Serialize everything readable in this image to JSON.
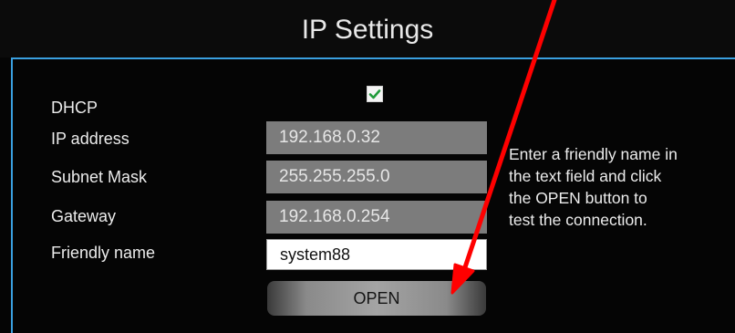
{
  "dialog": {
    "title": "IP Settings"
  },
  "form": {
    "dhcp_label": "DHCP",
    "dhcp_checked": true,
    "ip_label": "IP address",
    "ip_value": "192.168.0.32",
    "subnet_label": "Subnet Mask",
    "subnet_value": "255.255.255.0",
    "gateway_label": "Gateway",
    "gateway_value": "192.168.0.254",
    "friendly_label": "Friendly name",
    "friendly_value": "system88"
  },
  "help": {
    "line1": "Enter a friendly name in",
    "line2": "the text field and click",
    "line3": "the OPEN button to",
    "line4": "test the connection."
  },
  "actions": {
    "open_label": "OPEN"
  },
  "colors": {
    "accent_border": "#3aa0e0",
    "annotation_arrow": "#ff0000",
    "checkbox_check": "#1f9a3a"
  }
}
